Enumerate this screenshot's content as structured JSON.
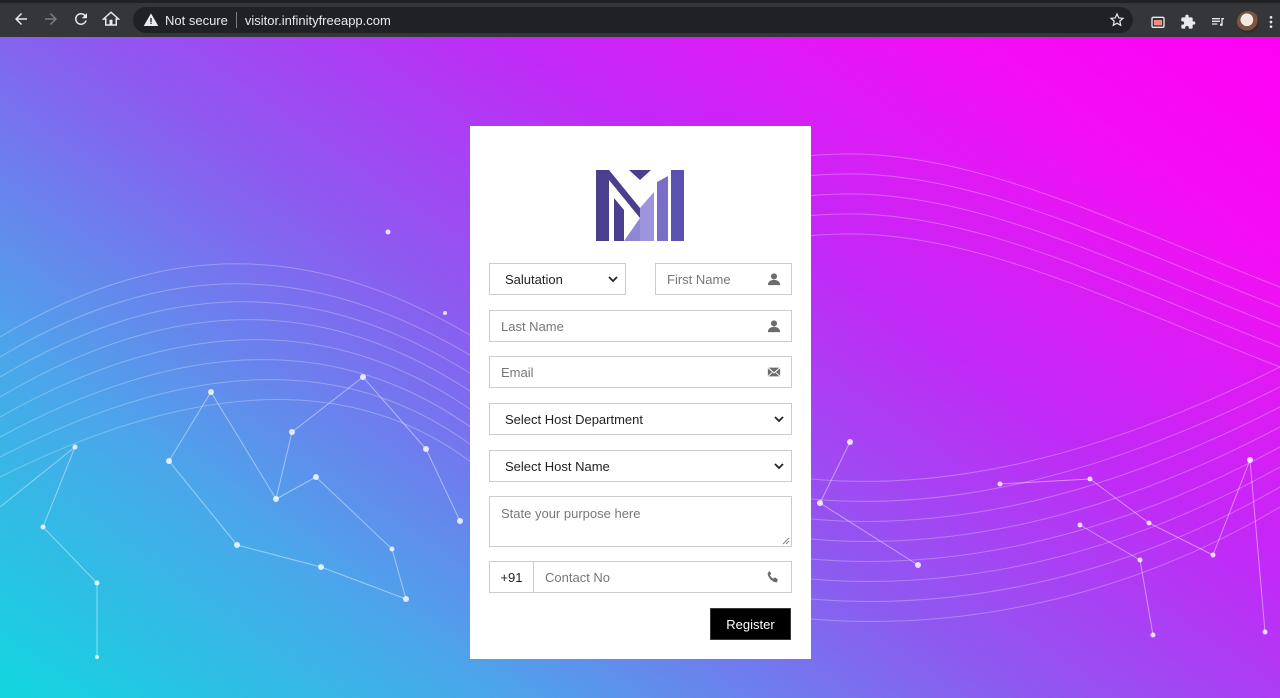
{
  "browser": {
    "security_label": "Not secure",
    "url": "visitor.infinityfreeapp.com"
  },
  "form": {
    "salutation": {
      "selected": "Salutation"
    },
    "first_name": {
      "placeholder": "First Name"
    },
    "last_name": {
      "placeholder": "Last Name"
    },
    "email": {
      "placeholder": "Email"
    },
    "host_department": {
      "selected": "Select Host Department"
    },
    "host_name": {
      "selected": "Select Host Name"
    },
    "purpose": {
      "placeholder": "State your purpose here"
    },
    "phone": {
      "prefix": "+91",
      "placeholder": "Contact No"
    },
    "register_label": "Register"
  },
  "icons": {
    "back": "arrow-left-icon",
    "forward": "arrow-right-icon",
    "reload": "reload-icon",
    "home": "home-icon",
    "warning": "warning-icon",
    "bookmark": "star-icon",
    "user": "user-icon",
    "mail": "envelope-icon",
    "phone": "phone-icon"
  },
  "colors": {
    "gradient_start": "#12d6df",
    "gradient_mid": "#8b5cf0",
    "gradient_end": "#ff00f5",
    "logo_dark": "#4a3f8c",
    "logo_light": "#8f86d4",
    "button_bg": "#000000"
  }
}
